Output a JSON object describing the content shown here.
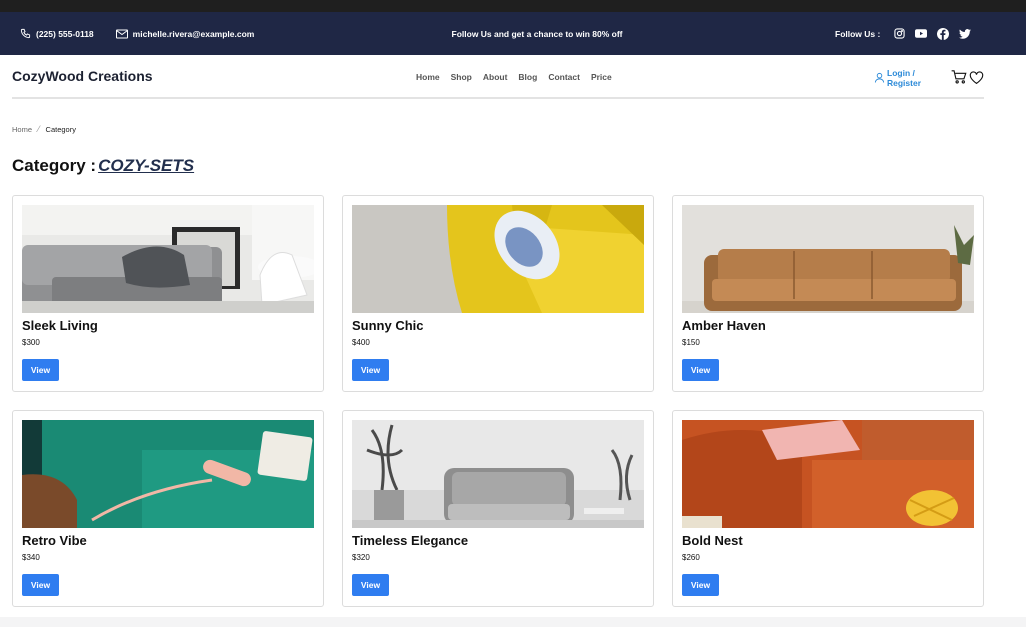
{
  "topbar": {
    "phone": "(225) 555-0118",
    "email": "michelle.rivera@example.com",
    "promo": "Follow Us and get a chance to win 80% off",
    "follow_label": "Follow Us :",
    "social_icons": [
      "instagram-icon",
      "youtube-icon",
      "facebook-icon",
      "twitter-icon"
    ]
  },
  "header": {
    "brand": "CozyWood Creations",
    "menu": [
      "Home",
      "Shop",
      "About",
      "Blog",
      "Contact",
      "Price"
    ],
    "login_label": "Login / Register"
  },
  "breadcrumb": {
    "home": "Home",
    "current": "Category"
  },
  "page": {
    "title_prefix": "Category :",
    "category": "COZY-SETS"
  },
  "products": [
    {
      "name": "Sleek Living",
      "price": "$300",
      "button": "View"
    },
    {
      "name": "Sunny Chic",
      "price": "$400",
      "button": "View"
    },
    {
      "name": "Amber Haven",
      "price": "$150",
      "button": "View"
    },
    {
      "name": "Retro Vibe",
      "price": "$340",
      "button": "View"
    },
    {
      "name": "Timeless Elegance",
      "price": "$320",
      "button": "View"
    },
    {
      "name": "Bold Nest",
      "price": "$260",
      "button": "View"
    }
  ],
  "colors": {
    "topbar_bg": "#1f2745",
    "button": "#2f7df0",
    "link_blue": "#2c8ad8",
    "category_text": "#222f4d"
  }
}
